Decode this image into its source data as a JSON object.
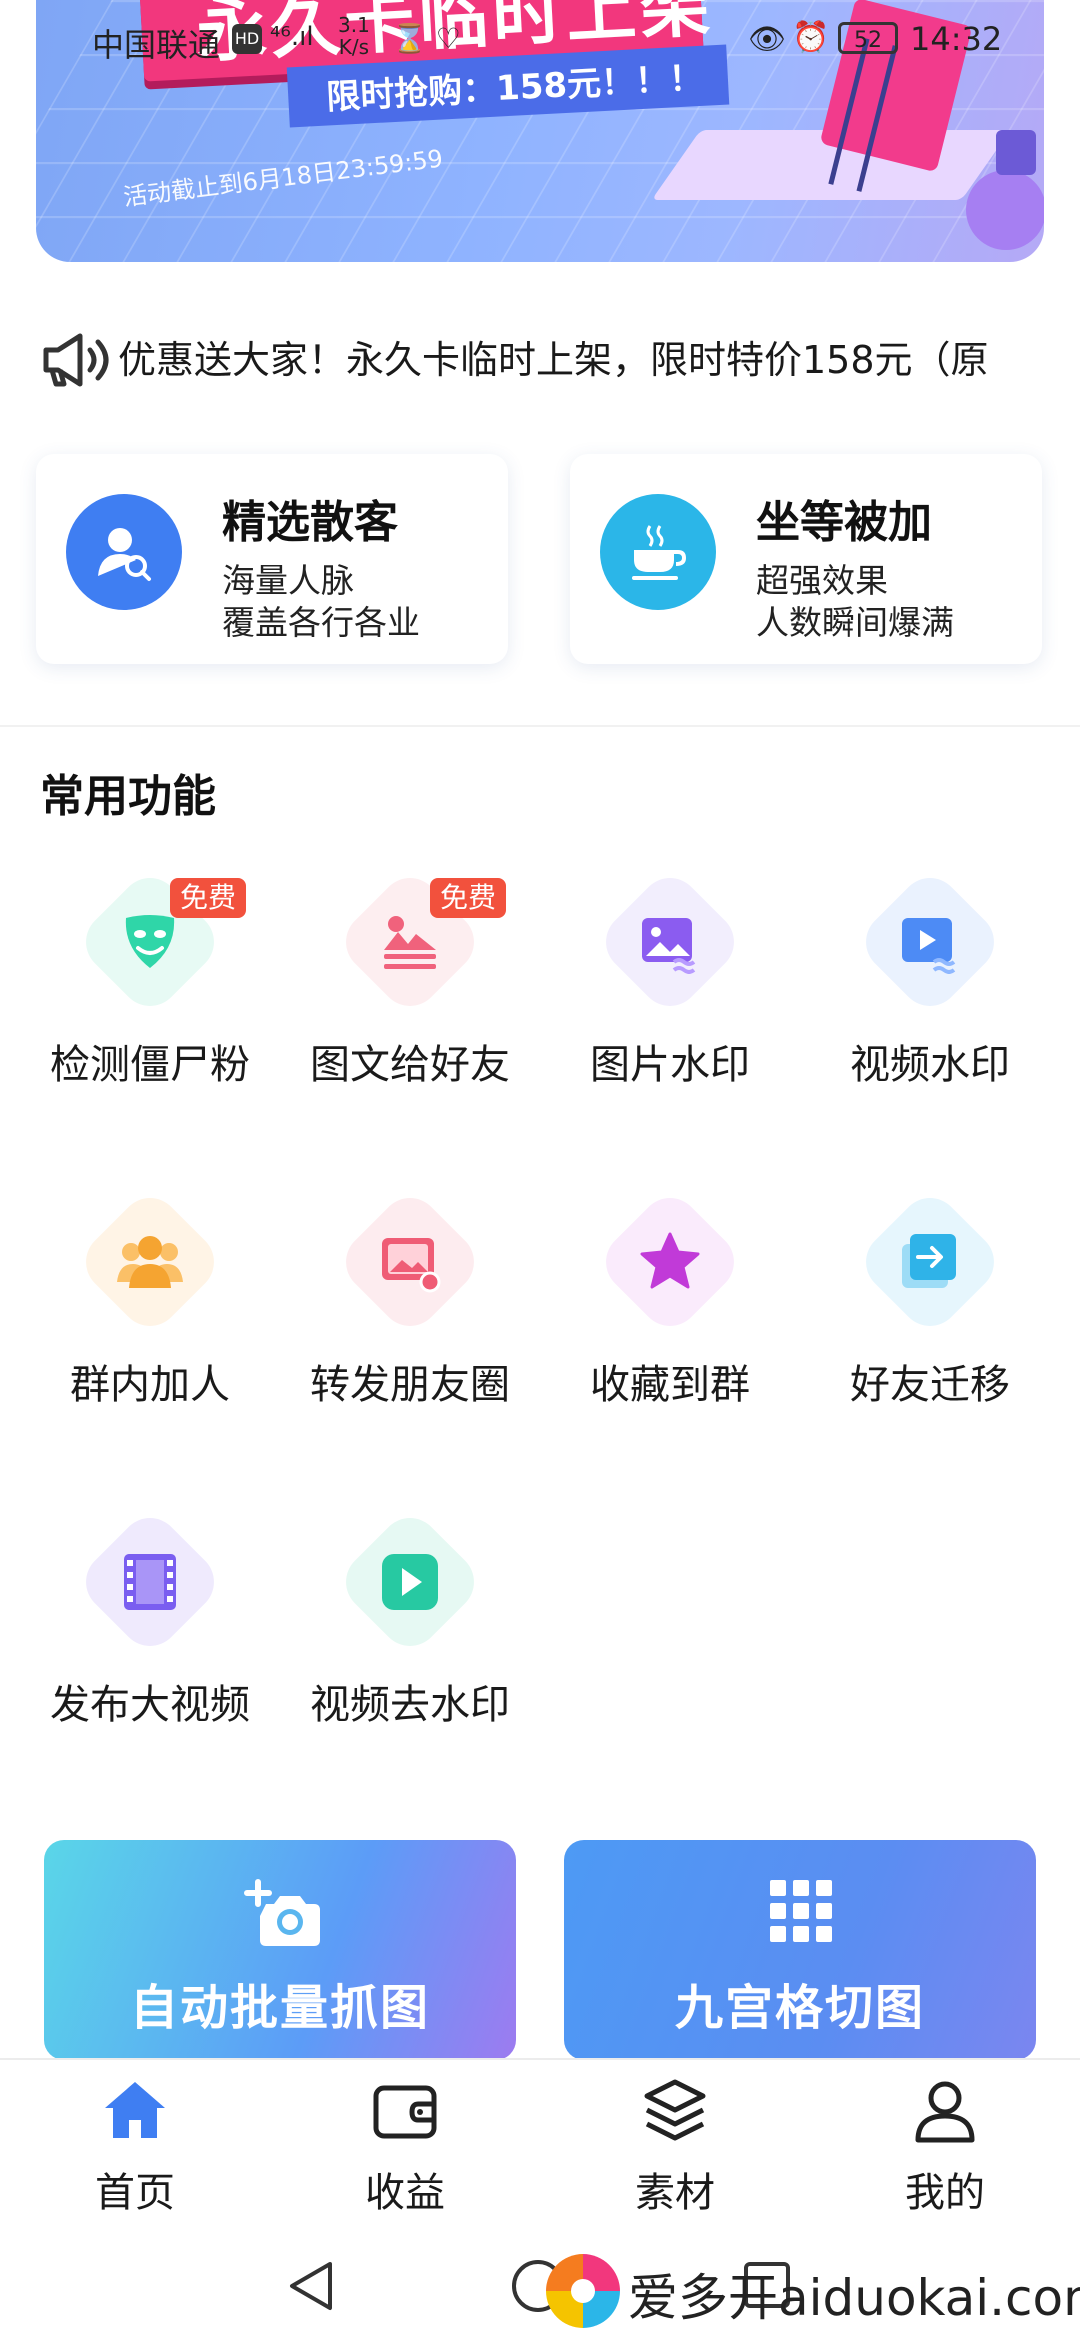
{
  "status_bar": {
    "carrier": "中国联通",
    "hd": "HD",
    "signal": "⁴⁶.ıl",
    "speed_value": "3.1",
    "speed_unit": "K/s",
    "battery": "52",
    "time": "14:32"
  },
  "banner": {
    "title": "永久卡临时上架",
    "price": "限时抢购：158元！！！",
    "deadline": "活动截止到6月18日23:59:59"
  },
  "marquee": {
    "text": "优惠送大家！永久卡临时上架，限时特价158元（原"
  },
  "features": [
    {
      "title": "精选散客",
      "line1": "海量人脉",
      "line2": "覆盖各行各业"
    },
    {
      "title": "坐等被加",
      "line1": "超强效果",
      "line2": "人数瞬间爆满"
    }
  ],
  "section": {
    "title": "常用功能"
  },
  "functions": [
    {
      "label": "检测僵尸粉",
      "badge": "免费",
      "icon": "mask-icon",
      "color": "#2fd6a8",
      "bg": "#e7faf4"
    },
    {
      "label": "图文给好友",
      "badge": "免费",
      "icon": "image-text-icon",
      "color": "#f0627c",
      "bg": "#fdeef0"
    },
    {
      "label": "图片水印",
      "badge": "",
      "icon": "image-watermark-icon",
      "color": "#8b5cf0",
      "bg": "#f2eefd"
    },
    {
      "label": "视频水印",
      "badge": "",
      "icon": "video-watermark-icon",
      "color": "#4d8bf5",
      "bg": "#eaf2fe"
    },
    {
      "label": "群内加人",
      "badge": "",
      "icon": "group-icon",
      "color": "#f5a431",
      "bg": "#fff4e6"
    },
    {
      "label": "转发朋友圈",
      "badge": "",
      "icon": "photo-forward-icon",
      "color": "#ef5c75",
      "bg": "#fdecef"
    },
    {
      "label": "收藏到群",
      "badge": "",
      "icon": "star-icon",
      "color": "#c13ad8",
      "bg": "#faebfc"
    },
    {
      "label": "好友迁移",
      "badge": "",
      "icon": "transfer-icon",
      "color": "#2fb3e8",
      "bg": "#e6f6fd"
    },
    {
      "label": "发布大视频",
      "badge": "",
      "icon": "film-icon",
      "color": "#7a5ef0",
      "bg": "#efeafd"
    },
    {
      "label": "视频去水印",
      "badge": "",
      "icon": "play-icon",
      "color": "#27c9a2",
      "bg": "#e6f9f3"
    }
  ],
  "promos": [
    {
      "label": "自动批量抓图",
      "icon": "camera-add-icon"
    },
    {
      "label": "九宫格切图",
      "icon": "grid-icon"
    }
  ],
  "tabs": [
    {
      "label": "首页",
      "icon": "home-icon",
      "active": true
    },
    {
      "label": "收益",
      "icon": "wallet-icon",
      "active": false
    },
    {
      "label": "素材",
      "icon": "layers-icon",
      "active": false
    },
    {
      "label": "我的",
      "icon": "user-icon",
      "active": false
    }
  ],
  "watermark": {
    "text": "爱多开aiduokai.com"
  },
  "colors": {
    "accent": "#3f7ef2",
    "badge": "#f2513d",
    "banner_pink": "#f2377d"
  }
}
